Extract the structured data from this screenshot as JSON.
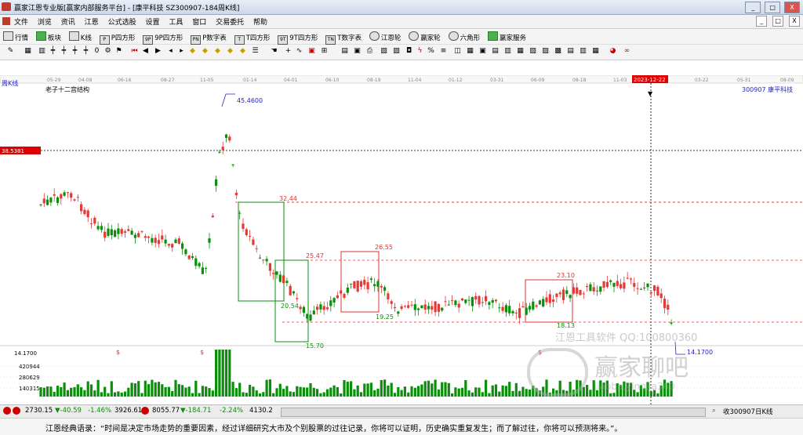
{
  "window": {
    "title": "赢家江恩专业版[赢家内部服务平台] - [康平科技  SZ300907-184周K线]",
    "min": "_",
    "max": "□",
    "close": "X"
  },
  "menu": [
    "文件",
    "浏览",
    "资讯",
    "江恩",
    "公式选股",
    "设置",
    "工具",
    "窗口",
    "交易委托",
    "帮助"
  ],
  "mdi": [
    "_",
    "□",
    "X"
  ],
  "toolbar1": [
    {
      "icon": "grid-icon",
      "label": "行情"
    },
    {
      "icon": "blocks-icon",
      "label": "板块"
    },
    {
      "icon": "candle-icon",
      "label": "K线"
    },
    {
      "icon": "P",
      "label": "P四方形"
    },
    {
      "icon": "9P",
      "label": "9P四方形"
    },
    {
      "icon": "PN",
      "label": "P数字表"
    },
    {
      "icon": "T",
      "label": "T四方形"
    },
    {
      "icon": "9T",
      "label": "9T四方形"
    },
    {
      "icon": "TN",
      "label": "T数字表"
    },
    {
      "icon": "wheel-icon",
      "label": "江恩轮"
    },
    {
      "icon": "wheel2-icon",
      "label": "赢家轮"
    },
    {
      "icon": "hexagon-icon",
      "label": "六角形"
    },
    {
      "icon": "dollar-icon",
      "label": "赢家服务"
    }
  ],
  "chart": {
    "period_label": "周K线",
    "indicator_label": "老子十二宫结构",
    "stock": "300907  康平科技",
    "dates": [
      "05-29",
      "04-08",
      "06-16",
      "08-27",
      "11-05",
      "01-14",
      "04-01",
      "06-10",
      "08-19",
      "11-04",
      "01-12",
      "03-31",
      "06-09",
      "08-18",
      "11-03",
      "2023-12-22",
      "03-22",
      "05-31",
      "08-09"
    ],
    "cursor_date": "2023-12-22",
    "price_high_label": "45.4600",
    "price_low_label": "14.1700",
    "cursor_price": "38.5381",
    "box_labels": {
      "a": "32.44",
      "b": "25.47",
      "c": "26.55",
      "d": "20.54",
      "e": "19.25",
      "f": "15.70",
      "g": "23.10",
      "h": "18.13"
    },
    "axis_left": "14.1700",
    "volume_ticks": [
      "420944",
      "280629",
      "140315"
    ],
    "dividend_markers": [
      "$",
      "$",
      "$"
    ],
    "watermark": {
      "line1": "江恩工具软件  QQ:100800360",
      "line2": "赢家聊吧",
      "line3": "jiaoba.yingjia360"
    }
  },
  "status": {
    "sh": "2730.15",
    "sh_change": "▼-40.59",
    "sh_pct": "-1.46%",
    "sh_vol": "3926.61",
    "sz": "8055.77",
    "sz_change": "▼-184.71",
    "sz_pct": "-2.24%",
    "sz_vol": "4130.2",
    "right": "收300907日K线"
  },
  "quote": "江恩经典语录：“时间是决定市场走势的重要因素，经过详细研究大市及个别股票的过往记录，你将可以证明，历史确实重复发生；而了解过往，你将可以预测将来。”。",
  "colors": {
    "up": "#e53935",
    "down": "#0a8f0a",
    "accent": "#2222cc",
    "grid": "#d33"
  }
}
